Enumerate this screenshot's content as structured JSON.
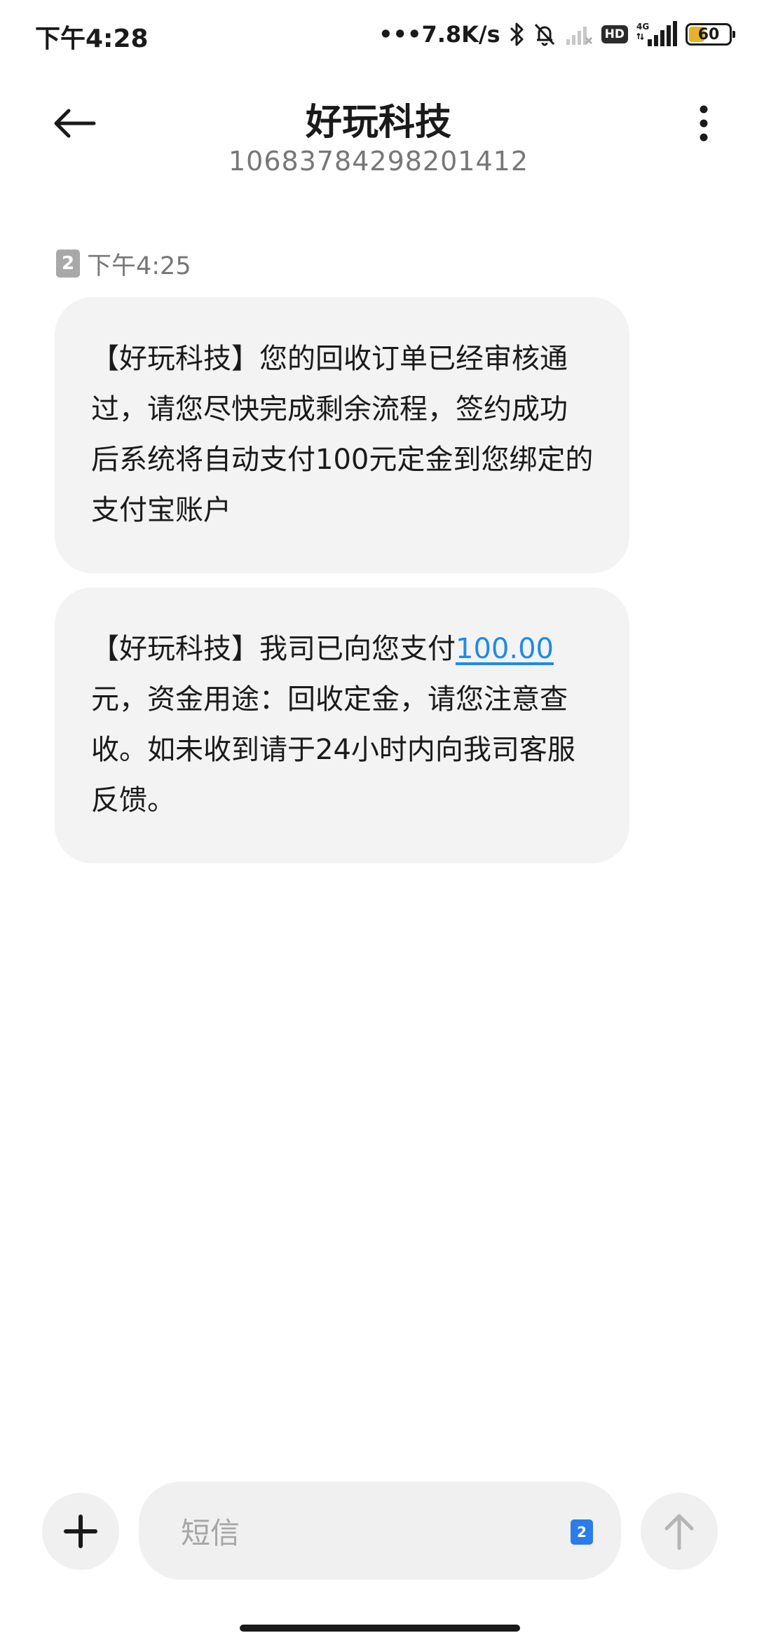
{
  "status_bar": {
    "time": "下午4:28",
    "net_speed": "•••7.8K/s",
    "hd_label": "HD",
    "network_label": "4G",
    "battery": "60",
    "battery_color": "#e8b228",
    "icons": [
      "bluetooth-icon",
      "mute-bell-icon",
      "wifi-off-icon",
      "hd-icon",
      "signal-icon",
      "battery-icon"
    ]
  },
  "header": {
    "contact_name": "好玩科技",
    "contact_number": "10683784298201412",
    "back_icon": "arrow-left-icon",
    "more_icon": "more-vertical-icon"
  },
  "conversation": {
    "timestamp": "下午4:25",
    "sim_slot": "2",
    "messages": [
      {
        "text": "【好玩科技】您的回收订单已经审核通过，请您尽快完成剩余流程，签约成功后系统将自动支付100元定金到您绑定的支付宝账户"
      },
      {
        "text_before": "【好玩科技】我司已向您支付",
        "amount": "100.00",
        "text_after": "元，资金用途：回收定金，请您注意查收。如未收到请于24小时内向我司客服反馈。",
        "link_color": "#1e8be6"
      }
    ]
  },
  "composer": {
    "placeholder": "短信",
    "sim_slot": "2",
    "add_icon": "plus-icon",
    "send_icon": "arrow-up-icon"
  }
}
